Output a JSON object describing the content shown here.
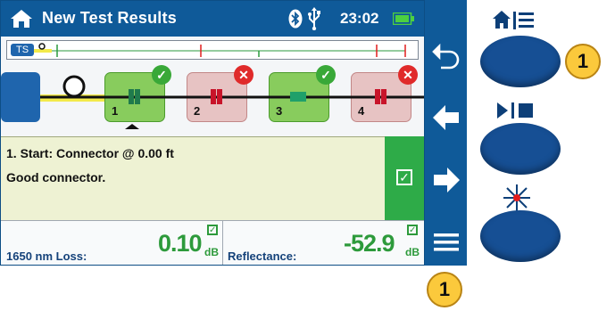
{
  "header": {
    "title": "New Test Results",
    "time": "23:02",
    "icons": {
      "home": "home-icon",
      "bluetooth": "bluetooth-icon",
      "usb": "usb-icon",
      "battery": "battery-icon"
    }
  },
  "trace": {
    "label": "TS"
  },
  "events": [
    {
      "number": "1",
      "status": "pass"
    },
    {
      "number": "2",
      "status": "fail"
    },
    {
      "number": "3",
      "status": "pass"
    },
    {
      "number": "4",
      "status": "fail"
    }
  ],
  "event_detail": {
    "title": "1. Start: Connector @ 0.00 ft",
    "description": "Good connector."
  },
  "results": {
    "loss_label": "1650 nm Loss:",
    "loss_value": "0.10",
    "loss_unit": "dB",
    "reflectance_label": "Reflectance:",
    "reflectance_value": "-52.9",
    "reflectance_unit": "dB"
  },
  "sidebar": {
    "buttons": [
      "back-icon",
      "arrow-left-icon",
      "arrow-right-icon",
      "menu-icon"
    ]
  },
  "hardware": {
    "top_symbol": "home-menu-icon",
    "mid_symbol": "play-stop-icon",
    "bottom_symbol": "laser-icon"
  },
  "callouts": {
    "top": "1",
    "bottom": "1"
  },
  "colors": {
    "title_bar": "#0f5a99",
    "pass_green": "#2eab48",
    "fail_red": "#e02a2a",
    "event_good": "#88cc5d",
    "event_bad": "#e7c3c3",
    "info_bg": "#eef2d3",
    "hardware_button": "#164f94",
    "callout": "#fbc93c"
  }
}
